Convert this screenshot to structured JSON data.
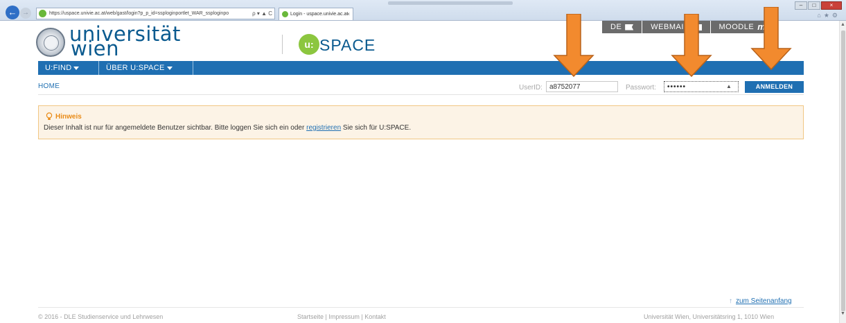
{
  "browser": {
    "address": "https://uspace.univie.ac.at/web/gast/login?p_p_id=ssploginportlet_WAR_ssploginpo",
    "address_controls": "ρ ▾ ▲ C",
    "tab_title": "Login - uspace.univie.ac.at",
    "tab_close": "×"
  },
  "header": {
    "logo_line1": "universität",
    "logo_line2": "wien",
    "uspace_mark": "u:",
    "uspace_text": "SPACE",
    "lang": "DE",
    "webmail": "WEBMAIL",
    "moodle": "MOODLE"
  },
  "nav": {
    "items": [
      "U:FIND",
      "ÜBER U:SPACE"
    ]
  },
  "breadcrumb": "HOME",
  "login": {
    "userid_label": "UserID:",
    "userid_value": "a8752077",
    "password_label": "Passwort:",
    "password_value": "••••••",
    "button": "ANMELDEN"
  },
  "notice": {
    "title": "Hinweis",
    "text_before": "Dieser Inhalt ist nur für angemeldete Benutzer sichtbar. Bitte loggen Sie sich ein oder ",
    "link": "registrieren",
    "text_after": " Sie sich für U:SPACE."
  },
  "footer": {
    "to_top_arrow": "↑",
    "to_top": "zum Seitenanfang",
    "copyright": "© 2016 - DLE Studienservice und Lehrwesen",
    "links": "Startseite | Impressum | Kontakt",
    "address": "Universität Wien, Universitätsring 1, 1010 Wien"
  },
  "colors": {
    "primary_blue": "#1f6fb2",
    "uspace_green": "#8cc63f",
    "notice_orange": "#e98b17",
    "annotation_arrow": "#f28a2e"
  }
}
